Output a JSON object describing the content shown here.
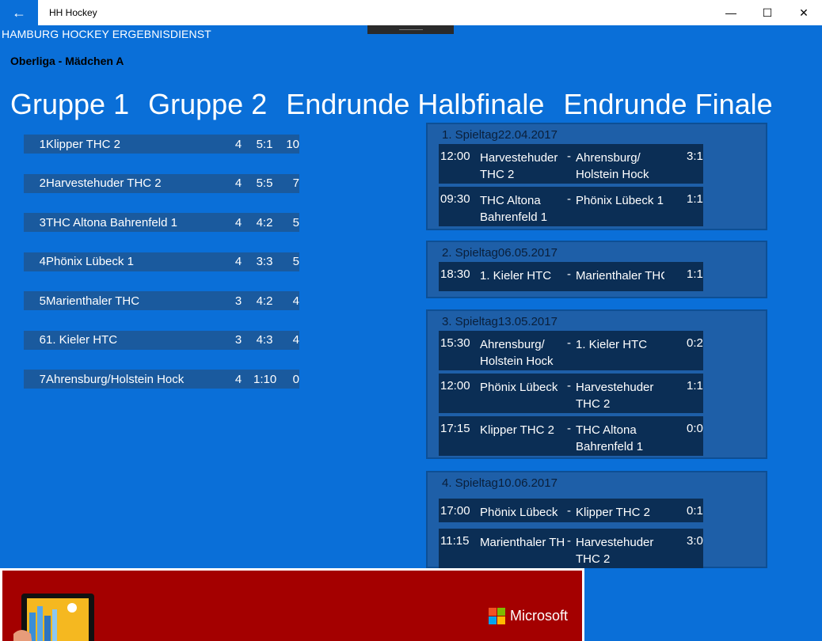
{
  "window": {
    "title": "HH Hockey",
    "back_icon": "←",
    "minimize_icon": "—",
    "maximize_icon": "☐",
    "close_icon": "✕"
  },
  "app": {
    "header": "HAMBURG HOCKEY ERGEBNISDIENST",
    "league": "Oberliga - Mädchen A"
  },
  "pivot": [
    "Gruppe 1",
    "Gruppe 2",
    "Endrunde Halbfinale",
    "Endrunde Finale"
  ],
  "standings": [
    {
      "rank": "1",
      "team": "Klipper THC 2",
      "games": "4",
      "goals": "5:1",
      "points": "10"
    },
    {
      "rank": "2",
      "team": "Harvestehuder THC 2",
      "games": "4",
      "goals": "5:5",
      "points": "7"
    },
    {
      "rank": "3",
      "team": "THC Altona Bahrenfeld 1",
      "games": "4",
      "goals": "4:2",
      "points": "5"
    },
    {
      "rank": "4",
      "team": "Phönix Lübeck 1",
      "games": "4",
      "goals": "3:3",
      "points": "5"
    },
    {
      "rank": "5",
      "team": "Marienthaler THC",
      "games": "3",
      "goals": "4:2",
      "points": "4"
    },
    {
      "rank": "6",
      "team": "1. Kieler HTC",
      "games": "3",
      "goals": "4:3",
      "points": "4"
    },
    {
      "rank": "7",
      "team": "Ahrensburg/Holstein Hock",
      "games": "4",
      "goals": "1:10",
      "points": "0"
    }
  ],
  "matchdays": [
    {
      "title": "1. Spieltag",
      "date": "22.04.2017",
      "games": [
        {
          "time": "12:00",
          "home": "Harvestehuder THC 2",
          "sep": "-",
          "away": "Ahrensburg/ Holstein Hock",
          "score": "3:1"
        },
        {
          "time": "09:30",
          "home": "THC Altona Bahrenfeld 1",
          "sep": "-",
          "away": "Phönix Lübeck 1",
          "score": "1:1"
        }
      ]
    },
    {
      "title": "2. Spieltag",
      "date": "06.05.2017",
      "games": [
        {
          "time": "18:30",
          "home": "1. Kieler HTC",
          "sep": "-",
          "away": "Marienthaler THC",
          "score": "1:1"
        }
      ]
    },
    {
      "title": "3. Spieltag",
      "date": "13.05.2017",
      "games": [
        {
          "time": "15:30",
          "home": "Ahrensburg/ Holstein Hock",
          "sep": "-",
          "away": "1. Kieler HTC",
          "score": "0:2"
        },
        {
          "time": "12:00",
          "home": "Phönix Lübeck",
          "sep": "-",
          "away": "Harvestehuder THC 2",
          "score": "1:1"
        },
        {
          "time": "17:15",
          "home": "Klipper THC 2",
          "sep": "-",
          "away": "THC Altona Bahrenfeld 1",
          "score": "0:0"
        }
      ]
    },
    {
      "title": "4. Spieltag",
      "date": "10.06.2017",
      "games": [
        {
          "time": "17:00",
          "home": "Phönix Lübeck",
          "sep": "-",
          "away": "Klipper THC 2",
          "score": "0:1"
        },
        {
          "time": "11:15",
          "home": "Marienthaler THC",
          "sep": "-",
          "away": "Harvestehuder THC 2",
          "score": "3:0"
        }
      ]
    }
  ],
  "ad": {
    "brand": "Microsoft"
  },
  "colors": {
    "accent": "#0a6fd8",
    "ad_bg": "#a40000"
  }
}
